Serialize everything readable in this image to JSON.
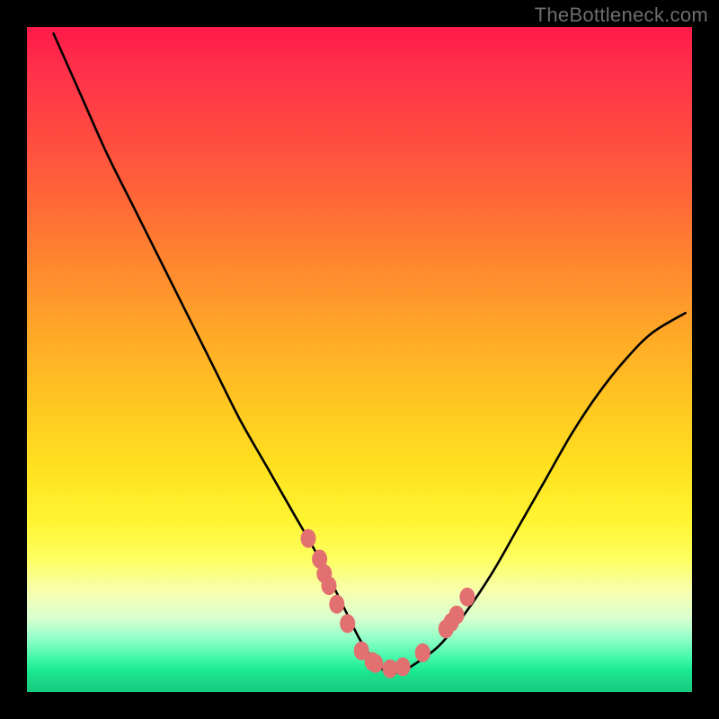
{
  "watermark": "TheBottleneck.com",
  "colors": {
    "background": "#000000",
    "curve": "#000000",
    "marker": "#e27070",
    "gradient_top": "#ff1a4a",
    "gradient_bottom": "#14cc80"
  },
  "chart_data": {
    "type": "line",
    "title": "",
    "xlabel": "",
    "ylabel": "",
    "xlim": [
      0,
      100
    ],
    "ylim": [
      0,
      100
    ],
    "curve": {
      "name": "bottleneck-curve",
      "x": [
        4,
        8,
        12,
        16,
        20,
        24,
        28,
        32,
        36,
        40,
        44,
        48,
        50,
        52,
        54,
        56,
        58,
        62,
        66,
        70,
        74,
        78,
        82,
        86,
        90,
        94,
        99
      ],
      "y": [
        99,
        90,
        81,
        73,
        65,
        57,
        49,
        41,
        34,
        27,
        20,
        12,
        8,
        5,
        3,
        3,
        4,
        7,
        12,
        18,
        25,
        32,
        39,
        45,
        50,
        54,
        57
      ]
    },
    "markers": {
      "name": "scatter-points",
      "x": [
        42.3,
        44.0,
        44.7,
        45.4,
        46.6,
        48.2,
        50.3,
        51.9,
        52.4,
        54.6,
        56.5,
        59.5,
        63.0,
        63.8,
        64.6,
        66.2
      ],
      "y": [
        23.1,
        20.0,
        17.8,
        16.0,
        13.2,
        10.3,
        6.2,
        4.6,
        4.3,
        3.5,
        3.8,
        5.9,
        9.5,
        10.5,
        11.6,
        14.3
      ]
    }
  }
}
